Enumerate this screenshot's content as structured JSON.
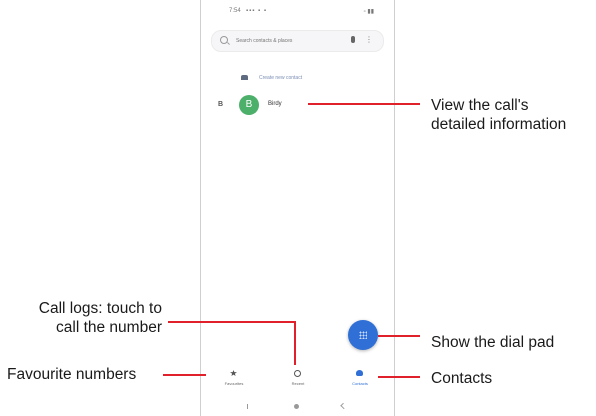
{
  "phone": {
    "status_time": "7:54",
    "status_icons": "▪▪▪ ▪ ▪",
    "status_right": "▫ ▮▮",
    "search_placeholder": "Search contacts & places",
    "more_glyph": "⋮",
    "create_contact_label": "Create new contact",
    "contact": {
      "section_letter": "B",
      "avatar_initial": "B",
      "name": "Birdy"
    },
    "bottom_nav": [
      {
        "label": "Favourites",
        "icon": "star-icon"
      },
      {
        "label": "Recent",
        "icon": "clock-icon"
      },
      {
        "label": "Contacts",
        "icon": "contacts-icon",
        "active": true
      }
    ],
    "colors": {
      "fab": "#2f6fd6",
      "avatar": "#4caf6a",
      "callout_line": "#e0202a"
    }
  },
  "callouts": {
    "view_call": "View the call's\ndetailed information",
    "call_logs": "Call logs: touch to\ncall the number",
    "dial_pad": "Show the dial pad",
    "favourites": "Favourite numbers",
    "contacts": "Contacts"
  }
}
